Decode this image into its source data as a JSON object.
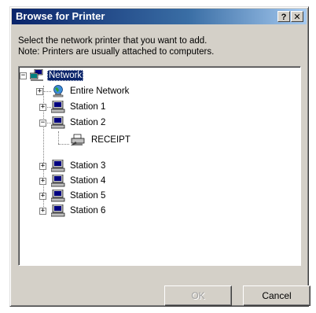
{
  "window": {
    "title": "Browse for Printer",
    "help_label": "?",
    "close_label": "✕"
  },
  "instructions": {
    "line1": "Select the network printer that you want to add.",
    "line2": "Note: Printers are usually attached to computers."
  },
  "tree": {
    "root": {
      "label": "Network",
      "icon": "network-icon",
      "expander": "−",
      "selected": true
    },
    "items": [
      {
        "label": "Entire Network",
        "icon": "globe-icon",
        "expander": "+"
      },
      {
        "label": "Station 1",
        "icon": "computer-icon",
        "expander": "+"
      },
      {
        "label": "Station 2",
        "icon": "computer-icon",
        "expander": "−"
      },
      {
        "label": "RECEIPT",
        "icon": "printer-icon",
        "expander": ""
      },
      {
        "label": "Station 3",
        "icon": "computer-icon",
        "expander": "+"
      },
      {
        "label": "Station 4",
        "icon": "computer-icon",
        "expander": "+"
      },
      {
        "label": "Station 5",
        "icon": "computer-icon",
        "expander": "+"
      },
      {
        "label": "Station 6",
        "icon": "computer-icon",
        "expander": "+"
      }
    ]
  },
  "buttons": {
    "ok_label": "OK",
    "ok_enabled": false,
    "cancel_label": "Cancel"
  },
  "colors": {
    "titlebar": "#0a246a",
    "dialog_face": "#d4d0c8",
    "selection": "#0a246a"
  }
}
